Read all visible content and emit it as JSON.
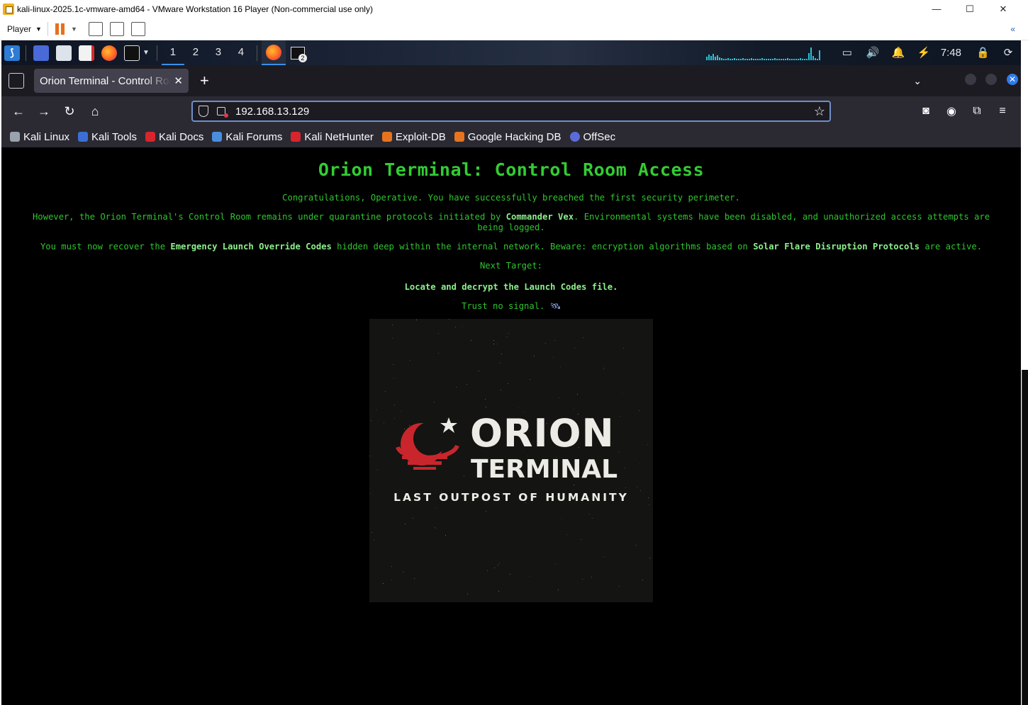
{
  "vm": {
    "title": "kali-linux-2025.1c-vmware-amd64 - VMware Workstation 16 Player (Non-commercial use only)",
    "minimize": "—",
    "maximize": "☐",
    "close": "✕",
    "player_menu": "Player",
    "collapse": "«"
  },
  "kali_panel": {
    "workspaces": [
      "1",
      "2",
      "3",
      "4"
    ],
    "terminal_badge": "2",
    "clock": "7:48"
  },
  "firefox": {
    "tab_title": "Orion Terminal - Control Room",
    "url": "192.168.13.129",
    "bookmarks": [
      {
        "label": "Kali Linux",
        "color": "#9aa3ad"
      },
      {
        "label": "Kali Tools",
        "color": "#3b6fd4"
      },
      {
        "label": "Kali Docs",
        "color": "#d8242c"
      },
      {
        "label": "Kali Forums",
        "color": "#4a8ee0"
      },
      {
        "label": "Kali NetHunter",
        "color": "#d8242c"
      },
      {
        "label": "Exploit-DB",
        "color": "#e8731e"
      },
      {
        "label": "Google Hacking DB",
        "color": "#e8731e"
      },
      {
        "label": "OffSec",
        "color": "#5b6cd8"
      }
    ]
  },
  "page": {
    "title": "Orion Terminal: Control Room Access",
    "p1": "Congratulations, Operative. You have successfully breached the first security perimeter.",
    "p2_a": "However, the Orion Terminal's Control Room remains under quarantine protocols initiated by ",
    "p2_hl": "Commander Vex",
    "p2_b": ". Environmental systems have been disabled, and unauthorized access attempts are being logged.",
    "p3_a": "You must now recover the ",
    "p3_hl1": "Emergency Launch Override Codes",
    "p3_b": " hidden deep within the internal network. Beware: encryption algorithms based on ",
    "p3_hl2": "Solar Flare Disruption Protocols",
    "p3_c": " are active.",
    "p4": "Next Target:",
    "p5": "Locate and decrypt the Launch Codes file.",
    "p6": "Trust no signal.",
    "p6_icon": "🛰"
  },
  "logo": {
    "word1": "ORION",
    "word2": "TERMINAL",
    "tagline": "LAST OUTPOST OF HUMANITY",
    "accent_color": "#c8262c"
  }
}
